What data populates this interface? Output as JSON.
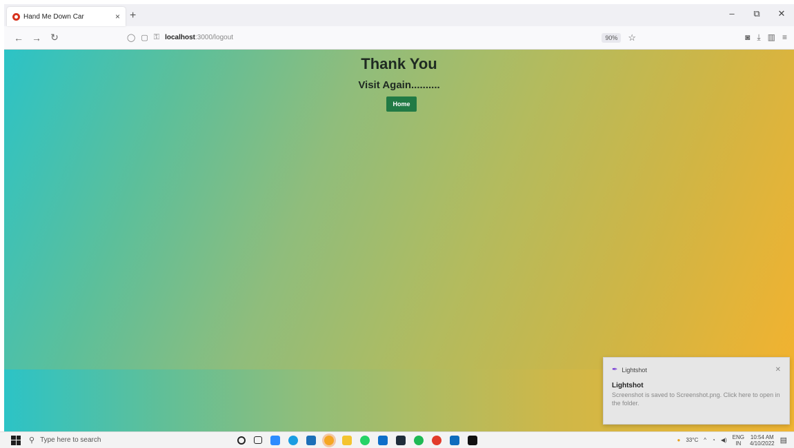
{
  "browser": {
    "tab_title": "Hand Me Down Car",
    "tab_close": "×",
    "new_tab": "+",
    "window_controls": [
      "–",
      "⧉",
      "✕"
    ],
    "url_host": "localhost",
    "url_rest": ":3000/logout",
    "zoom": "90%"
  },
  "page": {
    "title": "Thank You",
    "subtitle": "Visit Again..........",
    "home_button": "Home"
  },
  "toast": {
    "app": "Lightshot",
    "title": "Lightshot",
    "body": "Screenshot is saved to Screenshot.png. Click here to open in the folder."
  },
  "taskbar": {
    "search_placeholder": "Type here to search",
    "weather": "33°C",
    "lang": "ENG",
    "region": "IN",
    "time": "10:54 AM",
    "date": "4/10/2022"
  },
  "colors": {
    "home_button": "#217a45",
    "gradient_start": "#2cc3c6",
    "gradient_end": "#f6b22d"
  }
}
